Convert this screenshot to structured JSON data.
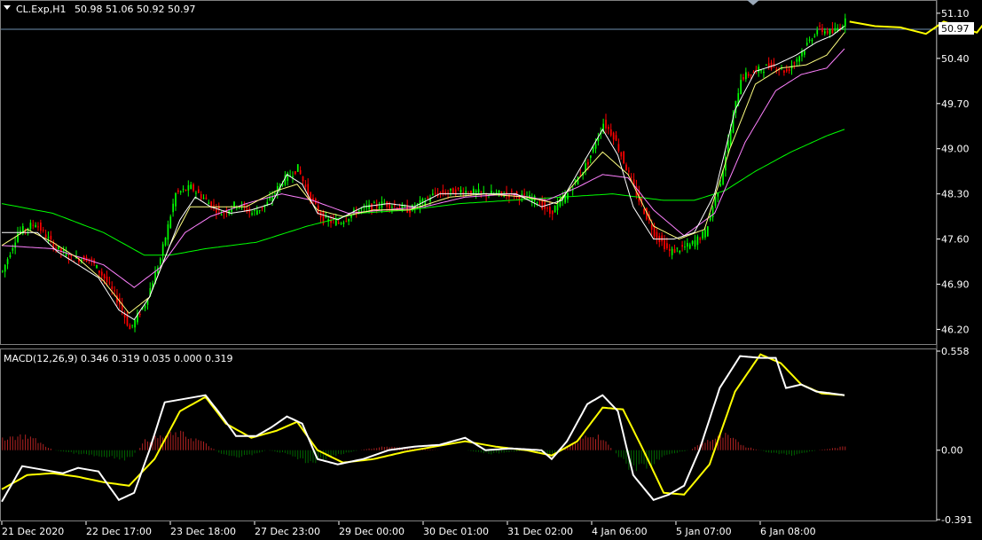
{
  "header": {
    "symbol_text": "CL.Exp,H1",
    "ohlc_text": "50.98 51.06 50.92 50.97"
  },
  "price_panel": {
    "y_ticks": [
      "51.10",
      "50.40",
      "49.70",
      "49.00",
      "48.30",
      "47.60",
      "46.90",
      "46.20"
    ],
    "current_price": "50.97"
  },
  "macd_panel": {
    "label": "MACD(12,26,9) 0.346 0.319 0.035 0.000 0.319",
    "y_ticks": [
      "0.558",
      "0.00",
      "-0.391"
    ]
  },
  "x_ticks": [
    "21 Dec 2020",
    "22 Dec 17:00",
    "23 Dec 18:00",
    "27 Dec 23:00",
    "29 Dec 00:00",
    "30 Dec 01:00",
    "31 Dec 02:00",
    "4 Jan 06:00",
    "5 Jan 07:00",
    "6 Jan 08:00"
  ],
  "colors": {
    "background": "#000000",
    "bull_candle": "#00ff00",
    "bear_candle": "#ff0000",
    "ma_fast": "#ffffff",
    "ma_mid": "#ffff80",
    "ma_slow": "#ff80ff",
    "ma_long": "#00ff00",
    "macd_line": "#ffffff",
    "signal_line": "#ffff00",
    "hist_pos": "#b22222",
    "hist_neg": "#006400",
    "arrow": "#ffff00",
    "grid_line": "#808080",
    "price_line": "#7090b0"
  },
  "chart_data": {
    "type": "candlestick",
    "price_anchor_path": [
      [
        0,
        47.1
      ],
      [
        6,
        47.7
      ],
      [
        13,
        47.85
      ],
      [
        20,
        47.5
      ],
      [
        27,
        47.3
      ],
      [
        34,
        47.3
      ],
      [
        40,
        47.0
      ],
      [
        46,
        46.6
      ],
      [
        50,
        46.2
      ],
      [
        56,
        46.6
      ],
      [
        62,
        47.3
      ],
      [
        68,
        48.3
      ],
      [
        74,
        48.4
      ],
      [
        80,
        48.2
      ],
      [
        86,
        48.0
      ],
      [
        92,
        48.15
      ],
      [
        98,
        48.0
      ],
      [
        104,
        48.15
      ],
      [
        110,
        48.5
      ],
      [
        116,
        48.7
      ],
      [
        120,
        48.3
      ],
      [
        126,
        47.9
      ],
      [
        132,
        47.85
      ],
      [
        140,
        48.05
      ],
      [
        150,
        48.15
      ],
      [
        160,
        48.05
      ],
      [
        170,
        48.3
      ],
      [
        180,
        48.35
      ],
      [
        190,
        48.3
      ],
      [
        200,
        48.3
      ],
      [
        210,
        48.2
      ],
      [
        215,
        48.0
      ],
      [
        222,
        48.3
      ],
      [
        230,
        48.8
      ],
      [
        236,
        49.4
      ],
      [
        240,
        49.2
      ],
      [
        244,
        48.8
      ],
      [
        250,
        48.2
      ],
      [
        256,
        47.7
      ],
      [
        262,
        47.4
      ],
      [
        270,
        47.5
      ],
      [
        276,
        47.7
      ],
      [
        282,
        48.5
      ],
      [
        290,
        50.1
      ],
      [
        296,
        50.2
      ],
      [
        302,
        50.3
      ],
      [
        308,
        50.2
      ],
      [
        314,
        50.5
      ],
      [
        320,
        50.85
      ],
      [
        326,
        50.8
      ],
      [
        331,
        50.97
      ]
    ],
    "ma_fast_path": [
      [
        0,
        47.7
      ],
      [
        8,
        47.7
      ],
      [
        14,
        47.7
      ],
      [
        22,
        47.4
      ],
      [
        30,
        47.2
      ],
      [
        38,
        47.0
      ],
      [
        46,
        46.5
      ],
      [
        52,
        46.35
      ],
      [
        58,
        46.7
      ],
      [
        64,
        47.3
      ],
      [
        70,
        47.9
      ],
      [
        76,
        48.25
      ],
      [
        82,
        48.1
      ],
      [
        90,
        48.0
      ],
      [
        98,
        48.05
      ],
      [
        106,
        48.15
      ],
      [
        112,
        48.6
      ],
      [
        118,
        48.45
      ],
      [
        124,
        48.0
      ],
      [
        132,
        47.9
      ],
      [
        142,
        48.1
      ],
      [
        152,
        48.15
      ],
      [
        162,
        48.1
      ],
      [
        172,
        48.3
      ],
      [
        182,
        48.3
      ],
      [
        192,
        48.3
      ],
      [
        202,
        48.3
      ],
      [
        212,
        48.1
      ],
      [
        220,
        48.2
      ],
      [
        228,
        48.75
      ],
      [
        236,
        49.3
      ],
      [
        242,
        48.9
      ],
      [
        248,
        48.1
      ],
      [
        256,
        47.6
      ],
      [
        264,
        47.6
      ],
      [
        272,
        47.7
      ],
      [
        280,
        48.3
      ],
      [
        288,
        49.6
      ],
      [
        296,
        50.2
      ],
      [
        304,
        50.3
      ],
      [
        312,
        50.45
      ],
      [
        320,
        50.65
      ],
      [
        326,
        50.75
      ],
      [
        331,
        50.9
      ]
    ],
    "ma_mid_path": [
      [
        0,
        47.5
      ],
      [
        10,
        47.75
      ],
      [
        20,
        47.55
      ],
      [
        30,
        47.3
      ],
      [
        40,
        46.95
      ],
      [
        50,
        46.45
      ],
      [
        58,
        46.7
      ],
      [
        66,
        47.5
      ],
      [
        74,
        48.1
      ],
      [
        84,
        48.1
      ],
      [
        96,
        48.1
      ],
      [
        108,
        48.35
      ],
      [
        116,
        48.45
      ],
      [
        124,
        48.05
      ],
      [
        134,
        47.95
      ],
      [
        146,
        48.05
      ],
      [
        160,
        48.05
      ],
      [
        176,
        48.25
      ],
      [
        190,
        48.3
      ],
      [
        206,
        48.25
      ],
      [
        218,
        48.15
      ],
      [
        228,
        48.6
      ],
      [
        236,
        48.95
      ],
      [
        246,
        48.6
      ],
      [
        256,
        47.8
      ],
      [
        266,
        47.6
      ],
      [
        276,
        47.75
      ],
      [
        286,
        49.0
      ],
      [
        296,
        50.0
      ],
      [
        306,
        50.25
      ],
      [
        316,
        50.3
      ],
      [
        324,
        50.45
      ],
      [
        331,
        50.8
      ]
    ],
    "ma_slow_path": [
      [
        0,
        47.5
      ],
      [
        20,
        47.45
      ],
      [
        40,
        47.2
      ],
      [
        52,
        46.85
      ],
      [
        62,
        47.15
      ],
      [
        72,
        47.7
      ],
      [
        82,
        47.95
      ],
      [
        96,
        48.15
      ],
      [
        110,
        48.3
      ],
      [
        122,
        48.2
      ],
      [
        136,
        48.0
      ],
      [
        150,
        48.05
      ],
      [
        166,
        48.1
      ],
      [
        182,
        48.25
      ],
      [
        200,
        48.3
      ],
      [
        214,
        48.2
      ],
      [
        226,
        48.4
      ],
      [
        236,
        48.6
      ],
      [
        246,
        48.55
      ],
      [
        256,
        48.05
      ],
      [
        268,
        47.65
      ],
      [
        280,
        48.0
      ],
      [
        292,
        49.1
      ],
      [
        304,
        49.9
      ],
      [
        314,
        50.15
      ],
      [
        324,
        50.25
      ],
      [
        331,
        50.55
      ]
    ],
    "ma_long_path": [
      [
        0,
        48.15
      ],
      [
        20,
        48.0
      ],
      [
        40,
        47.7
      ],
      [
        56,
        47.35
      ],
      [
        66,
        47.35
      ],
      [
        80,
        47.45
      ],
      [
        100,
        47.55
      ],
      [
        120,
        47.8
      ],
      [
        140,
        48.0
      ],
      [
        160,
        48.05
      ],
      [
        180,
        48.15
      ],
      [
        200,
        48.2
      ],
      [
        220,
        48.25
      ],
      [
        240,
        48.3
      ],
      [
        260,
        48.2
      ],
      [
        272,
        48.2
      ],
      [
        284,
        48.35
      ],
      [
        296,
        48.65
      ],
      [
        310,
        48.95
      ],
      [
        324,
        49.2
      ],
      [
        331,
        49.3
      ]
    ],
    "macd_anchor_path": [
      [
        0,
        -0.29
      ],
      [
        8,
        -0.09
      ],
      [
        16,
        -0.11
      ],
      [
        24,
        -0.13
      ],
      [
        30,
        -0.1
      ],
      [
        38,
        -0.12
      ],
      [
        46,
        -0.28
      ],
      [
        52,
        -0.24
      ],
      [
        58,
        0.0
      ],
      [
        64,
        0.27
      ],
      [
        72,
        0.29
      ],
      [
        80,
        0.31
      ],
      [
        86,
        0.2
      ],
      [
        92,
        0.08
      ],
      [
        100,
        0.08
      ],
      [
        106,
        0.13
      ],
      [
        112,
        0.19
      ],
      [
        118,
        0.15
      ],
      [
        124,
        -0.05
      ],
      [
        132,
        -0.08
      ],
      [
        142,
        -0.05
      ],
      [
        152,
        0.0
      ],
      [
        162,
        0.02
      ],
      [
        172,
        0.03
      ],
      [
        182,
        0.07
      ],
      [
        190,
        0.0
      ],
      [
        200,
        0.01
      ],
      [
        212,
        0.0
      ],
      [
        216,
        -0.05
      ],
      [
        222,
        0.05
      ],
      [
        230,
        0.26
      ],
      [
        236,
        0.31
      ],
      [
        242,
        0.22
      ],
      [
        248,
        -0.14
      ],
      [
        256,
        -0.28
      ],
      [
        262,
        -0.25
      ],
      [
        268,
        -0.2
      ],
      [
        274,
        0.0
      ],
      [
        282,
        0.35
      ],
      [
        290,
        0.53
      ],
      [
        298,
        0.52
      ],
      [
        304,
        0.52
      ],
      [
        308,
        0.35
      ],
      [
        314,
        0.37
      ],
      [
        320,
        0.33
      ],
      [
        326,
        0.32
      ],
      [
        331,
        0.31
      ]
    ],
    "signal_anchor_path": [
      [
        0,
        -0.22
      ],
      [
        10,
        -0.14
      ],
      [
        20,
        -0.13
      ],
      [
        30,
        -0.15
      ],
      [
        40,
        -0.18
      ],
      [
        50,
        -0.2
      ],
      [
        60,
        -0.05
      ],
      [
        70,
        0.22
      ],
      [
        80,
        0.3
      ],
      [
        88,
        0.15
      ],
      [
        98,
        0.07
      ],
      [
        108,
        0.11
      ],
      [
        116,
        0.16
      ],
      [
        124,
        0.0
      ],
      [
        134,
        -0.07
      ],
      [
        146,
        -0.05
      ],
      [
        158,
        -0.01
      ],
      [
        170,
        0.02
      ],
      [
        182,
        0.05
      ],
      [
        194,
        0.02
      ],
      [
        206,
        0.0
      ],
      [
        216,
        -0.03
      ],
      [
        226,
        0.05
      ],
      [
        236,
        0.24
      ],
      [
        244,
        0.23
      ],
      [
        252,
        0.0
      ],
      [
        260,
        -0.24
      ],
      [
        268,
        -0.25
      ],
      [
        278,
        -0.08
      ],
      [
        288,
        0.33
      ],
      [
        298,
        0.54
      ],
      [
        306,
        0.49
      ],
      [
        314,
        0.37
      ],
      [
        322,
        0.32
      ],
      [
        331,
        0.31
      ]
    ],
    "histogram_anchor_path": [
      [
        0,
        0.07
      ],
      [
        10,
        0.08
      ],
      [
        20,
        0.0
      ],
      [
        30,
        -0.02
      ],
      [
        40,
        -0.04
      ],
      [
        50,
        -0.05
      ],
      [
        56,
        0.05
      ],
      [
        64,
        0.08
      ],
      [
        70,
        0.09
      ],
      [
        78,
        0.05
      ],
      [
        86,
        -0.02
      ],
      [
        94,
        -0.04
      ],
      [
        104,
        0.0
      ],
      [
        112,
        -0.02
      ],
      [
        120,
        -0.07
      ],
      [
        128,
        -0.04
      ],
      [
        140,
        0.0
      ],
      [
        150,
        0.02
      ],
      [
        160,
        0.01
      ],
      [
        172,
        0.0
      ],
      [
        182,
        0.0
      ],
      [
        192,
        -0.02
      ],
      [
        206,
        0.0
      ],
      [
        216,
        -0.03
      ],
      [
        222,
        0.02
      ],
      [
        230,
        0.08
      ],
      [
        234,
        0.08
      ],
      [
        240,
        0.0
      ],
      [
        246,
        -0.1
      ],
      [
        254,
        -0.09
      ],
      [
        262,
        -0.02
      ],
      [
        270,
        0.0
      ],
      [
        276,
        0.05
      ],
      [
        284,
        0.08
      ],
      [
        292,
        0.02
      ],
      [
        300,
        -0.01
      ],
      [
        310,
        -0.03
      ],
      [
        320,
        0.0
      ],
      [
        326,
        0.01
      ],
      [
        331,
        0.02
      ]
    ],
    "forecast_arrow_path": [
      [
        333,
        50.97
      ],
      [
        343,
        50.9
      ],
      [
        353,
        50.88
      ],
      [
        363,
        50.78
      ],
      [
        370,
        50.97
      ],
      [
        383,
        50.8
      ],
      [
        393,
        51.3
      ]
    ],
    "y_range": [
      46.0,
      51.25
    ],
    "macd_range": [
      -0.391,
      0.558
    ],
    "bar_count": 332
  }
}
